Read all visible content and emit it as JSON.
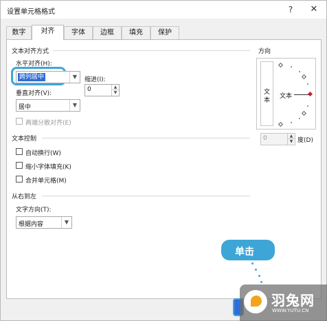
{
  "window": {
    "title": "设置单元格格式",
    "help": "?",
    "close": "✕"
  },
  "tabs": [
    "数字",
    "对齐",
    "字体",
    "边框",
    "填充",
    "保护"
  ],
  "alignment": {
    "section": "文本对齐方式",
    "horizontal_label": "水平对齐(H):",
    "horizontal_value": "跨列居中",
    "indent_label": "缩进(I):",
    "indent_value": "0",
    "vertical_label": "垂直对齐(V):",
    "vertical_value": "居中",
    "distributed_label": "两端分散对齐(E)"
  },
  "text_control": {
    "section": "文本控制",
    "wrap": "自动换行(W)",
    "shrink": "缩小字体填充(K)",
    "merge": "合并单元格(M)"
  },
  "rtl": {
    "section": "从右到左",
    "direction_label": "文字方向(T):",
    "direction_value": "根据内容"
  },
  "orientation": {
    "section": "方向",
    "vertical_chars": [
      "文",
      "本"
    ],
    "text_word": "文本",
    "degree_value": "0",
    "degree_label": "度(D)"
  },
  "callout": {
    "text": "单击"
  },
  "watermark": {
    "name": "羽兔网",
    "url": "WWW.YUTU.CN"
  },
  "colors": {
    "accent": "#3ea6d6",
    "selection": "#2f6ed8",
    "needle_tip": "#c0242c"
  },
  "icons": {
    "dropdown": "chevron-down-icon",
    "spin_up": "spin-up-icon",
    "spin_down": "spin-down-icon"
  }
}
